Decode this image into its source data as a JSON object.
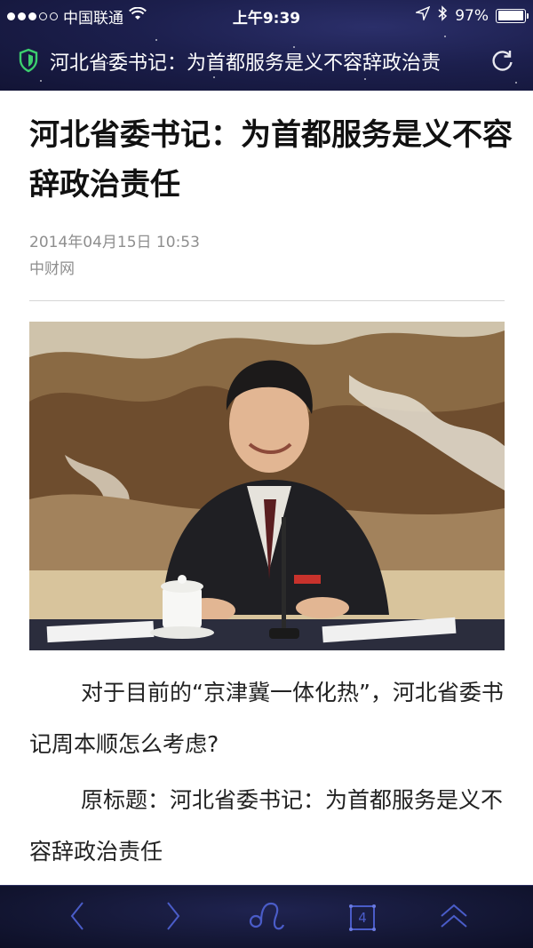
{
  "status_bar": {
    "carrier": "中国联通",
    "time": "上午9:39",
    "battery": "97%",
    "battery_level": 0.97
  },
  "url_bar": {
    "page_title": "河北省委书记：为首都服务是义不容辞政治责"
  },
  "article": {
    "title": "河北省委书记：为首都服务是义不容辞政治责任",
    "date": "2014年04月15日 10:53",
    "source": "中财网",
    "paragraphs": [
      "对于目前的“京津冀一体化热”，河北省委书记周本顺怎么考虑?",
      "原标题：河北省委书记：为首都服务是义不容辞政治责任"
    ]
  },
  "toolbar": {
    "tab_count": "4"
  },
  "colors": {
    "header_bg": "#1c1f4d",
    "accent_green": "#3ccf6e",
    "toolbar_icon": "#4a5cc8"
  }
}
